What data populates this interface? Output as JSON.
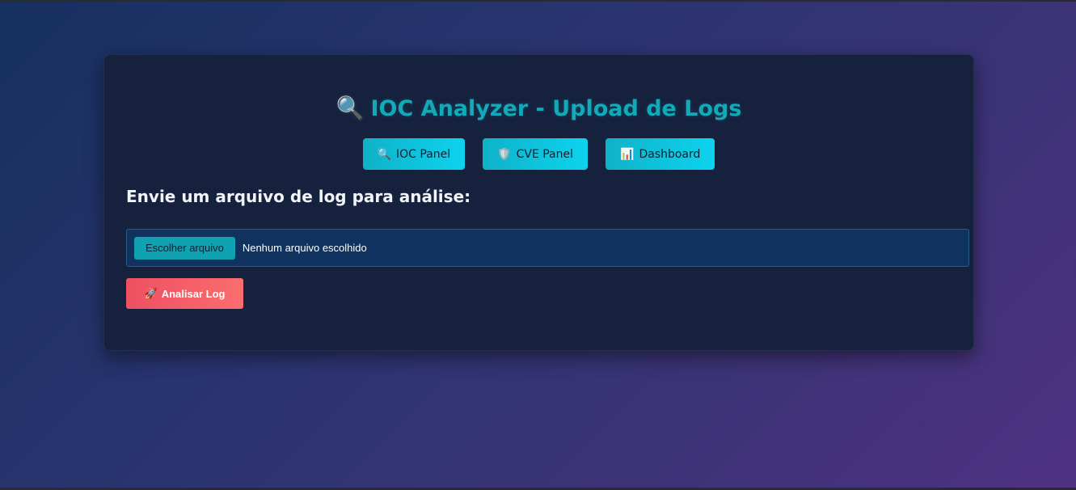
{
  "page": {
    "title": "IOC Analyzer - Upload de Logs",
    "title_icon": "🔍"
  },
  "nav": {
    "buttons": [
      {
        "icon": "🔍",
        "icon_name": "magnifier-icon",
        "label": "IOC Panel"
      },
      {
        "icon": "🛡️",
        "icon_name": "shield-icon",
        "label": "CVE Panel"
      },
      {
        "icon": "📊",
        "icon_name": "bar-chart-icon",
        "label": "Dashboard"
      }
    ]
  },
  "upload": {
    "heading": "Envie um arquivo de log para análise:",
    "choose_label": "Escolher arquivo",
    "file_status": "Nenhum arquivo escolhido",
    "submit_icon": "🚀",
    "submit_label": "Analisar Log"
  },
  "colors": {
    "accent": "#0fb2c7",
    "title": "#12a9b8",
    "submit": "#f0556a",
    "card_bg": "#16213d"
  }
}
